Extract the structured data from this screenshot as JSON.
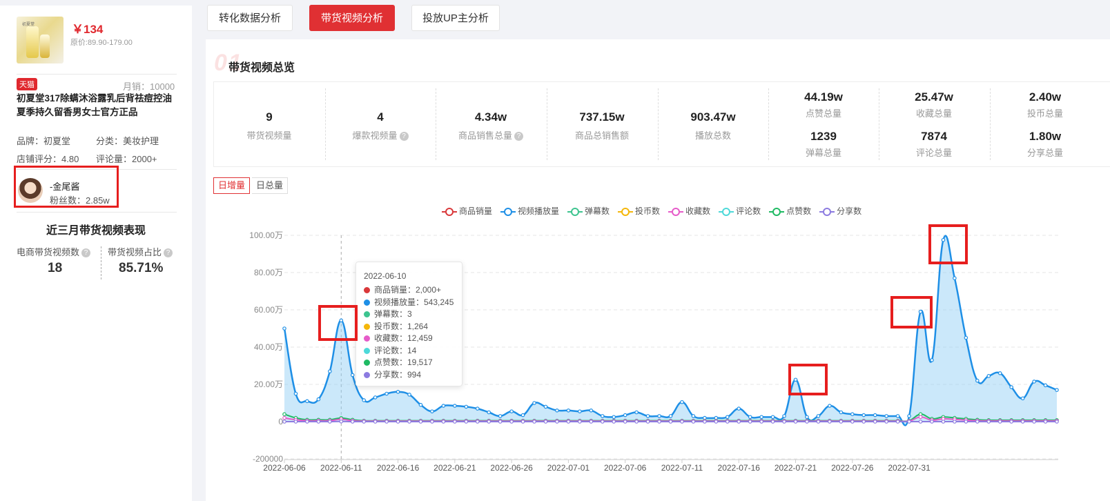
{
  "product": {
    "price": "￥134",
    "original_price": "原价:89.90-179.00",
    "platform_badge": "天猫",
    "monthly_sales": "月销：10000",
    "title": "初夏堂317除螨沐浴露乳后背祛痘控油夏季持久留香男女士官方正品",
    "brand": "品牌：初夏堂",
    "category": "分类：美妆护理",
    "store_rating": "店铺评分：4.80",
    "review_count": "评论量：2000+"
  },
  "uploader": {
    "name": "-金尾酱",
    "fans": "粉丝数：2.85w"
  },
  "recent": {
    "title": "近三月带货视频表现",
    "video_count_label": "电商带货视频数",
    "video_count": "18",
    "video_ratio_label": "带货视频占比",
    "video_ratio": "85.71%"
  },
  "tabs": [
    {
      "label": "转化数据分析",
      "active": false
    },
    {
      "label": "带货视频分析",
      "active": true
    },
    {
      "label": "投放UP主分析",
      "active": false
    }
  ],
  "overview": {
    "title": "带货视频总览",
    "stats": [
      {
        "value": "9",
        "label": "带货视频量"
      },
      {
        "value": "4",
        "label": "爆款视频量"
      },
      {
        "value": "4.34w",
        "label": "商品销售总量"
      },
      {
        "value": "737.15w",
        "label": "商品总销售额"
      },
      {
        "value": "903.47w",
        "label": "播放总数"
      }
    ],
    "paired_stats": [
      {
        "value": "44.19w",
        "label": "点赞总量",
        "value2": "1239",
        "label2": "弹幕总量"
      },
      {
        "value": "25.47w",
        "label": "收藏总量",
        "value2": "7874",
        "label2": "评论总量"
      },
      {
        "value": "2.40w",
        "label": "投币总量",
        "value2": "1.80w",
        "label2": "分享总量"
      }
    ]
  },
  "toggle": {
    "daily_increase": "日增量",
    "daily_total": "日总量"
  },
  "tooltip": {
    "date": "2022-06-10",
    "rows": [
      {
        "label": "商品销量：2,000+",
        "color": "#d9383a"
      },
      {
        "label": "视频播放量：543,245",
        "color": "#1e8fe6"
      },
      {
        "label": "弹幕数：3",
        "color": "#3dc48f"
      },
      {
        "label": "投币数：1,264",
        "color": "#f5b70a"
      },
      {
        "label": "收藏数：12,459",
        "color": "#e65bc9"
      },
      {
        "label": "评论数：14",
        "color": "#4dd9d9"
      },
      {
        "label": "点赞数：19,517",
        "color": "#1fba63"
      },
      {
        "label": "分享数：994",
        "color": "#8c7be0"
      }
    ]
  },
  "chart_data": {
    "type": "line",
    "legend": [
      "商品销量",
      "视频播放量",
      "弹幕数",
      "投币数",
      "收藏数",
      "评论数",
      "点赞数",
      "分享数"
    ],
    "legend_colors": [
      "#d9383a",
      "#1e8fe6",
      "#3dc48f",
      "#f5b70a",
      "#e65bc9",
      "#4dd9d9",
      "#1fba63",
      "#8c7be0"
    ],
    "x_ticks": [
      "2022-06-06",
      "2022-06-11",
      "2022-06-16",
      "2022-06-21",
      "2022-06-26",
      "2022-07-01",
      "2022-07-06",
      "2022-07-11",
      "2022-07-16",
      "2022-07-21",
      "2022-07-26",
      "2022-07-31"
    ],
    "y_ticks": [
      "100.00万",
      "80.00万",
      "60.00万",
      "40.00万",
      "20.00万",
      "0",
      "-200000"
    ],
    "ylim": [
      -200000,
      1000000
    ],
    "start_date": "2022-06-06",
    "series": [
      {
        "name": "视频播放量",
        "color": "#1e8fe6",
        "area": true,
        "values": [
          500000,
          150000,
          110000,
          120000,
          270000,
          543245,
          250000,
          115000,
          130000,
          150000,
          160000,
          145000,
          90000,
          55000,
          85000,
          85000,
          80000,
          70000,
          50000,
          30000,
          55000,
          35000,
          100000,
          80000,
          60000,
          60000,
          55000,
          60000,
          30000,
          25000,
          35000,
          50000,
          30000,
          30000,
          30000,
          105000,
          30000,
          20000,
          20000,
          25000,
          70000,
          25000,
          25000,
          25000,
          30000,
          225000,
          25000,
          30000,
          85000,
          50000,
          40000,
          35000,
          35000,
          30000,
          30000,
          30000,
          590000,
          330000,
          975000,
          770000,
          450000,
          220000,
          245000,
          260000,
          185000,
          125000,
          215000,
          195000,
          170000
        ]
      },
      {
        "name": "点赞数",
        "color": "#1fba63",
        "values": [
          40000,
          20000,
          10000,
          10000,
          10000,
          19517,
          10000,
          5000,
          5000,
          5000,
          5000,
          5000,
          5000,
          5000,
          5000,
          5000,
          5000,
          5000,
          5000,
          5000,
          5000,
          5000,
          5000,
          5000,
          5000,
          5000,
          5000,
          5000,
          5000,
          5000,
          5000,
          5000,
          5000,
          5000,
          5000,
          5000,
          5000,
          5000,
          5000,
          5000,
          5000,
          5000,
          5000,
          5000,
          5000,
          5000,
          5000,
          5000,
          5000,
          5000,
          5000,
          5000,
          5000,
          5000,
          5000,
          5000,
          40000,
          15000,
          25000,
          20000,
          15000,
          10000,
          8000,
          8000,
          8000,
          8000,
          8000,
          8000,
          8000
        ]
      },
      {
        "name": "收藏数",
        "color": "#e65bc9",
        "values": [
          20000,
          10000,
          5000,
          5000,
          5000,
          12459,
          5000,
          3000,
          3000,
          3000,
          3000,
          3000,
          3000,
          3000,
          3000,
          3000,
          3000,
          3000,
          3000,
          3000,
          3000,
          3000,
          3000,
          3000,
          3000,
          3000,
          3000,
          3000,
          3000,
          3000,
          3000,
          3000,
          3000,
          3000,
          3000,
          3000,
          3000,
          3000,
          3000,
          3000,
          3000,
          3000,
          3000,
          3000,
          3000,
          3000,
          3000,
          3000,
          3000,
          3000,
          3000,
          3000,
          3000,
          3000,
          3000,
          3000,
          25000,
          8000,
          15000,
          12000,
          8000,
          5000,
          4000,
          4000,
          4000,
          4000,
          4000,
          4000,
          4000
        ]
      },
      {
        "name": "分享数",
        "color": "#8c7be0",
        "values": [
          0,
          0,
          0,
          0,
          0,
          994,
          0,
          0,
          0,
          0,
          0,
          0,
          0,
          0,
          0,
          0,
          0,
          0,
          0,
          0,
          0,
          0,
          0,
          0,
          0,
          0,
          0,
          0,
          0,
          0,
          0,
          0,
          0,
          0,
          0,
          0,
          0,
          0,
          0,
          0,
          0,
          0,
          0,
          0,
          0,
          0,
          0,
          0,
          0,
          0,
          0,
          0,
          0,
          0,
          0,
          0,
          0,
          0,
          0,
          0,
          0,
          0,
          0,
          0,
          0,
          0,
          0,
          0,
          0
        ]
      }
    ],
    "grid": true,
    "legend_position": "top-center"
  }
}
